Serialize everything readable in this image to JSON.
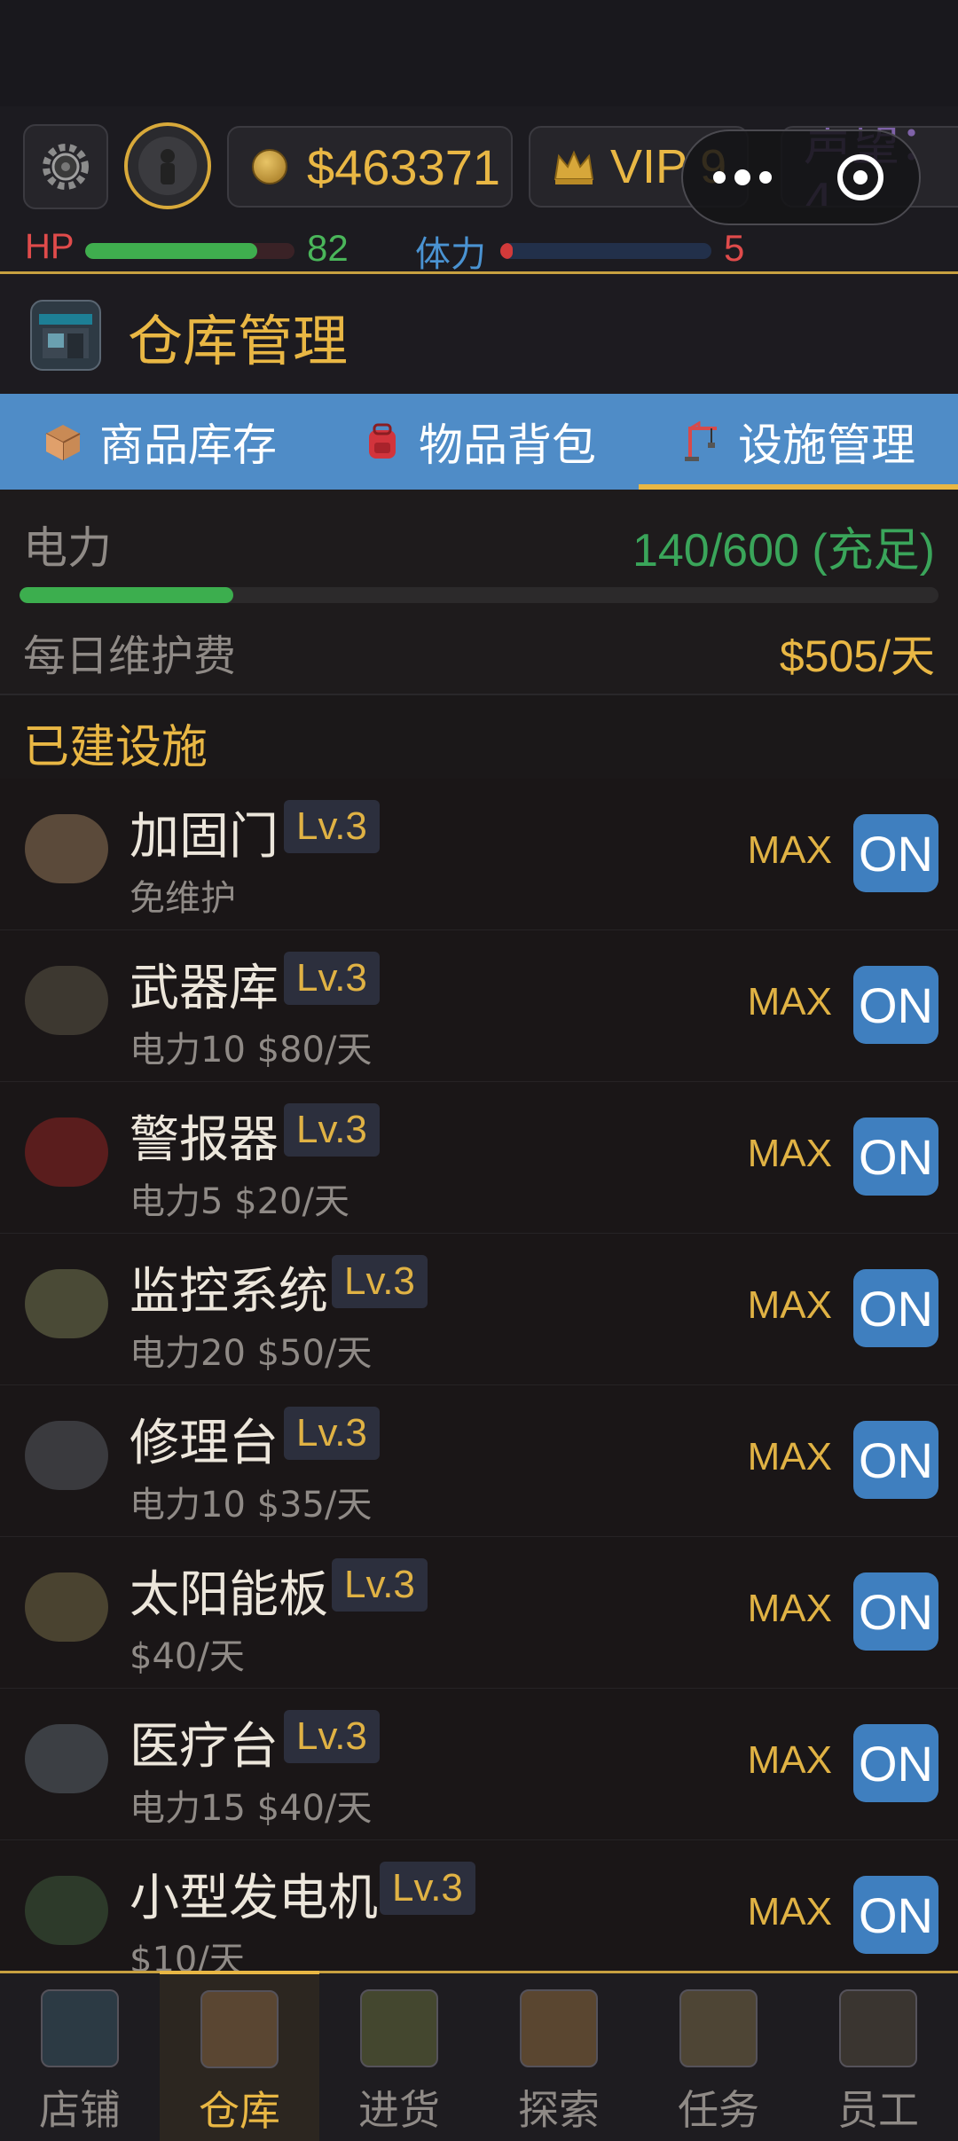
{
  "hud": {
    "money": "$463371",
    "vip": "VIP 9",
    "reputation": "声望：4",
    "hp_label": "HP",
    "hp_value": "82",
    "hp_fraction": 0.82,
    "stamina_label": "体力",
    "stamina_value": "5",
    "stamina_fraction": 0.05
  },
  "page": {
    "title": "仓库管理"
  },
  "tabs": [
    {
      "label": "商品库存",
      "icon": "package-icon",
      "active": false
    },
    {
      "label": "物品背包",
      "icon": "backpack-icon",
      "active": false
    },
    {
      "label": "设施管理",
      "icon": "crane-icon",
      "active": true
    }
  ],
  "power": {
    "label": "电力",
    "value": "140/600 (充足)",
    "fraction": 0.233,
    "maintenance_label": "每日维护费",
    "maintenance_value": "$505/天"
  },
  "section": {
    "title": "已建设施"
  },
  "facilities": [
    {
      "name": "加固门",
      "level": "Lv.3",
      "sub": "免维护",
      "max": "MAX",
      "toggle": "ON",
      "icon": "door-icon"
    },
    {
      "name": "武器库",
      "level": "Lv.3",
      "sub": "电力10 $80/天",
      "max": "MAX",
      "toggle": "ON",
      "icon": "rifle-icon"
    },
    {
      "name": "警报器",
      "level": "Lv.3",
      "sub": "电力5 $20/天",
      "max": "MAX",
      "toggle": "ON",
      "icon": "alarm-icon"
    },
    {
      "name": "监控系统",
      "level": "Lv.3",
      "sub": "电力20 $50/天",
      "max": "MAX",
      "toggle": "ON",
      "icon": "monitor-icon"
    },
    {
      "name": "修理台",
      "level": "Lv.3",
      "sub": "电力10 $35/天",
      "max": "MAX",
      "toggle": "ON",
      "icon": "wrench-icon"
    },
    {
      "name": "太阳能板",
      "level": "Lv.3",
      "sub": "$40/天",
      "max": "MAX",
      "toggle": "ON",
      "icon": "energy-icon"
    },
    {
      "name": "医疗台",
      "level": "Lv.3",
      "sub": "电力15 $40/天",
      "max": "MAX",
      "toggle": "ON",
      "icon": "medical-icon"
    },
    {
      "name": "小型发电机",
      "level": "Lv.3",
      "sub": "$10/天",
      "max": "MAX",
      "toggle": "ON",
      "icon": "battery-icon"
    }
  ],
  "nav": [
    {
      "label": "店铺",
      "icon": "shop-icon",
      "active": false
    },
    {
      "label": "仓库",
      "icon": "warehouse-crate-icon",
      "active": true
    },
    {
      "label": "进货",
      "icon": "truck-icon",
      "active": false
    },
    {
      "label": "探索",
      "icon": "map-icon",
      "active": false
    },
    {
      "label": "任务",
      "icon": "task-board-icon",
      "active": false
    },
    {
      "label": "员工",
      "icon": "team-icon",
      "active": false
    }
  ],
  "colors": {
    "accent": "#e9b744",
    "tab_bg": "#4f8cc7",
    "toggle_on": "#3f7fbf",
    "power_green": "#3aa55a",
    "hp_red": "#e04b4b"
  }
}
